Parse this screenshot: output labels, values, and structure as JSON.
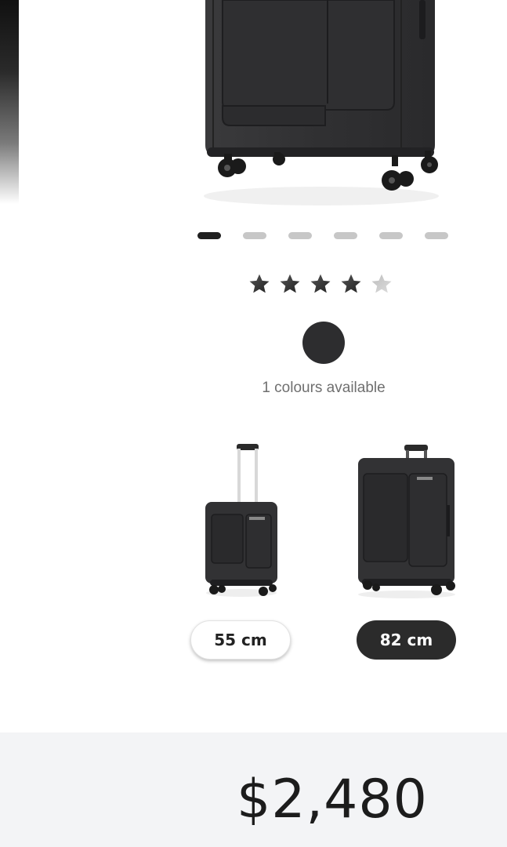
{
  "carousel": {
    "dot_count": 6,
    "active_index": 0
  },
  "rating": {
    "value": 4,
    "max": 5
  },
  "colours": {
    "swatch_color": "#2d2d2f",
    "available_text": "1 colours available"
  },
  "sizes": [
    {
      "label": "55 cm",
      "selected": false
    },
    {
      "label": "82 cm",
      "selected": true
    }
  ],
  "price": {
    "value": "$2,480"
  },
  "colors": {
    "accent_dark": "#2b2b2b",
    "dot_inactive": "#c7c7c7",
    "price_bg": "#f3f4f6"
  }
}
